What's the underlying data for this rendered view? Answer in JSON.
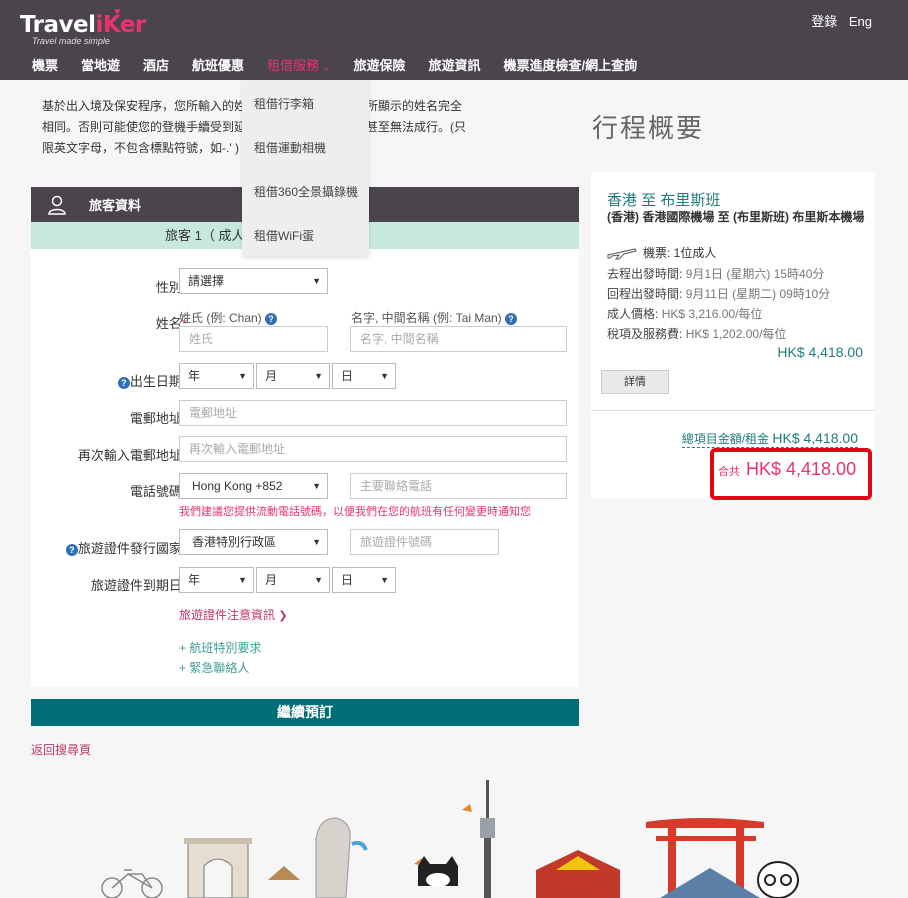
{
  "header": {
    "logo_text_1": "Travel",
    "logo_text_2": "iKer",
    "logo_tagline": "Travel made simple",
    "login": "登錄",
    "language": "Eng",
    "nav": [
      {
        "label": "機票"
      },
      {
        "label": "當地遊"
      },
      {
        "label": "酒店"
      },
      {
        "label": "航班優惠"
      },
      {
        "label": "租借服務"
      },
      {
        "label": "旅遊保險"
      },
      {
        "label": "旅遊資訊"
      },
      {
        "label": "機票進度檢查/網上查詢"
      }
    ]
  },
  "dropdown": [
    "租借行李箱",
    "租借運動相機",
    "租借360全景攝錄機",
    "租借WiFi蛋"
  ],
  "notice": {
    "line1": "基於出入境及保安程序，您所輸入的姓名必須與您旅遊證件上所顯示的姓名完全",
    "line2": "相同。否則可能使您的登機手續受到延誤，需繳付更改費用，甚至無法成行。(只",
    "line3": "限英文字母，不包含標點符號，如-.' )"
  },
  "form": {
    "panel_title": "旅客資料",
    "passenger_label": "旅客 1（ 成人 ）",
    "gender_label": "性別",
    "gender_value": "請選擇",
    "name_label": "姓名",
    "surname_label": "姓氏 (例: Chan)",
    "surname_placeholder": "姓氏",
    "given_label": "名字, 中間名稱 (例: Tai Man)",
    "given_placeholder": "名字, 中間名稱",
    "dob_label": "出生日期",
    "year": "年",
    "month": "月",
    "day": "日",
    "email_label": "電郵地址",
    "email_placeholder": "電郵地址",
    "email2_label": "再次輸入電郵地址",
    "email2_placeholder": "再次輸入電郵地址",
    "phone_label": "電話號碼",
    "phone_code": "Hong Kong +852",
    "phone_placeholder": "主要聯絡電話",
    "phone_hint": "我們建議您提供流動電話號碼，以便我們在您的航班有任何變更時通知您",
    "issue_label": "旅遊證件發行國家",
    "issue_value": "香港特別行政區",
    "passport_placeholder": "旅遊證件號碼",
    "expiry_label": "旅遊證件到期日",
    "doc_info": "旅遊證件注意資訊",
    "special_request": "+ 航班特別要求",
    "emergency_contact": "+ 緊急聯絡人",
    "req_mark": "*"
  },
  "continue_button": "繼續預訂",
  "back_link": "返回搜尋頁",
  "summary": {
    "title": "行程概要",
    "route": "香港  至  布里斯班",
    "airports": "(香港) 香港國際機場  至  (布里斯班) 布里斯本機場",
    "ticket": "機票: 1位成人",
    "depart_label": "去程出發時間:",
    "depart_value": "9月1日 (星期六) 15時40分",
    "return_label": "回程出發時間:",
    "return_value": "9月11日 (星期二) 09時10分",
    "adult_label": "成人價格:",
    "adult_value": "HK$ 3,216.00/每位",
    "tax_label": "稅項及服務費:",
    "tax_value": "HK$ 1,202.00/每位",
    "price": "HK$ 4,418.00",
    "details_button": "詳情",
    "subtotal_label": "總項目金額/租金",
    "subtotal_value": "HK$ 4,418.00",
    "total_label": "合共",
    "total_value": "HK$ 4,418.00"
  },
  "colors": {
    "header_bg": "#4a454c",
    "brand_pink": "#e8336f",
    "teal": "#006f75",
    "highlight_red": "#e30613"
  }
}
